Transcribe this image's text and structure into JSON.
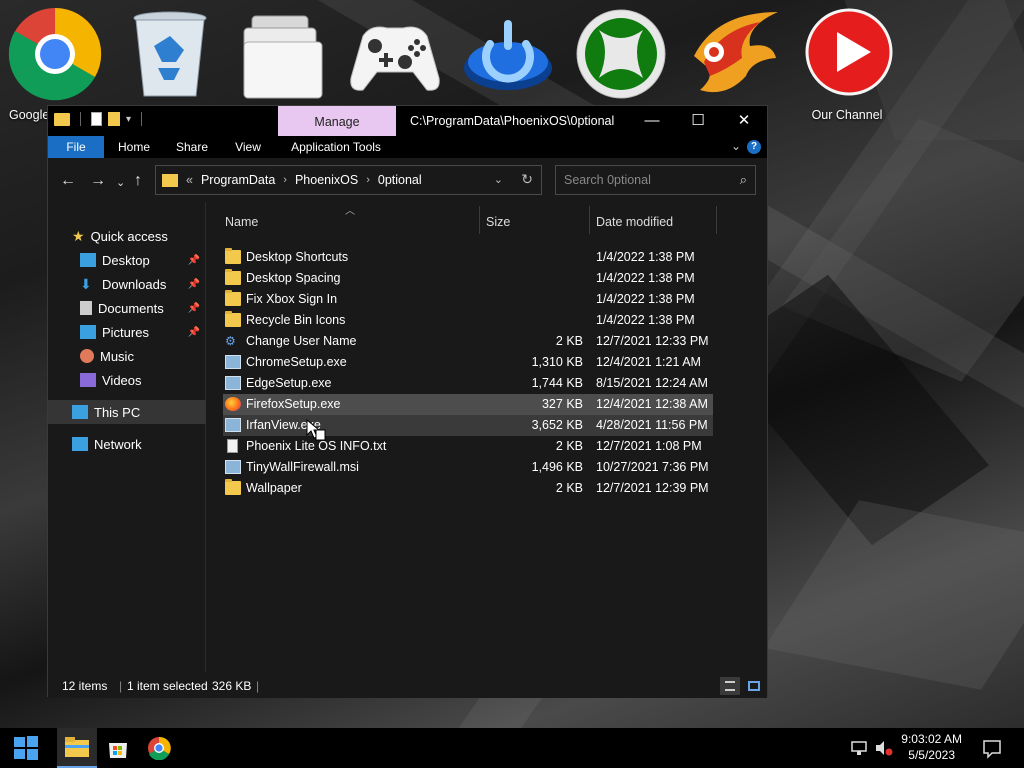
{
  "desktop": {
    "icons": [
      {
        "label": "Google",
        "icon": "chrome-icon"
      },
      {
        "label": "",
        "icon": "recycle-bin-icon"
      },
      {
        "label": "",
        "icon": "folders-icon"
      },
      {
        "label": "",
        "icon": "gamepad-icon"
      },
      {
        "label": "",
        "icon": "power-icon"
      },
      {
        "label": "",
        "icon": "xbox-icon"
      },
      {
        "label": "",
        "icon": "phoenix-icon"
      },
      {
        "label": "Our Channel",
        "icon": "play-icon"
      }
    ]
  },
  "window": {
    "title": "C:\\ProgramData\\PhoenixOS\\0ptional",
    "manage_tab": "Manage",
    "ribbon_tabs": [
      "File",
      "Home",
      "Share",
      "View",
      "Application Tools"
    ],
    "address": {
      "prefix": "«",
      "segments": [
        "ProgramData",
        "PhoenixOS",
        "0ptional"
      ]
    },
    "search_placeholder": "Search 0ptional",
    "columns": {
      "name": "Name",
      "size": "Size",
      "date": "Date modified"
    },
    "nav": {
      "quick_access": "Quick access",
      "desktop": "Desktop",
      "downloads": "Downloads",
      "documents": "Documents",
      "pictures": "Pictures",
      "music": "Music",
      "videos": "Videos",
      "this_pc": "This PC",
      "network": "Network"
    },
    "files": [
      {
        "name": "Desktop Shortcuts",
        "size": "",
        "date": "1/4/2022 1:38 PM",
        "type": "folder"
      },
      {
        "name": "Desktop Spacing",
        "size": "",
        "date": "1/4/2022 1:38 PM",
        "type": "folder"
      },
      {
        "name": "Fix Xbox Sign In",
        "size": "",
        "date": "1/4/2022 1:38 PM",
        "type": "folder"
      },
      {
        "name": "Recycle Bin Icons",
        "size": "",
        "date": "1/4/2022 1:38 PM",
        "type": "folder"
      },
      {
        "name": "Change User Name",
        "size": "2 KB",
        "date": "12/7/2021 12:33 PM",
        "type": "shortcut"
      },
      {
        "name": "ChromeSetup.exe",
        "size": "1,310 KB",
        "date": "12/4/2021 1:21 AM",
        "type": "exe"
      },
      {
        "name": "EdgeSetup.exe",
        "size": "1,744 KB",
        "date": "8/15/2021 12:24 AM",
        "type": "exe"
      },
      {
        "name": "FirefoxSetup.exe",
        "size": "327 KB",
        "date": "12/4/2021 12:38 AM",
        "type": "firefox",
        "selected": true
      },
      {
        "name": "IrfanView.exe",
        "size": "3,652 KB",
        "date": "4/28/2021 11:56 PM",
        "type": "exe",
        "hover": true
      },
      {
        "name": "Phoenix Lite OS INFO.txt",
        "size": "2 KB",
        "date": "12/7/2021 1:08 PM",
        "type": "txt"
      },
      {
        "name": "TinyWallFirewall.msi",
        "size": "1,496 KB",
        "date": "10/27/2021 7:36 PM",
        "type": "exe"
      },
      {
        "name": "Wallpaper",
        "size": "2 KB",
        "date": "12/7/2021 12:39 PM",
        "type": "folder"
      }
    ],
    "status": {
      "items": "12 items",
      "selected": "1 item selected",
      "selected_size": "326 KB"
    }
  },
  "taskbar": {
    "time": "9:03:02 AM",
    "date": "5/5/2023"
  },
  "colors": {
    "accent": "#1a6fc4",
    "manage": "#e8c8f0",
    "folder": "#f2c94c",
    "selection": "#4d4d4d"
  }
}
